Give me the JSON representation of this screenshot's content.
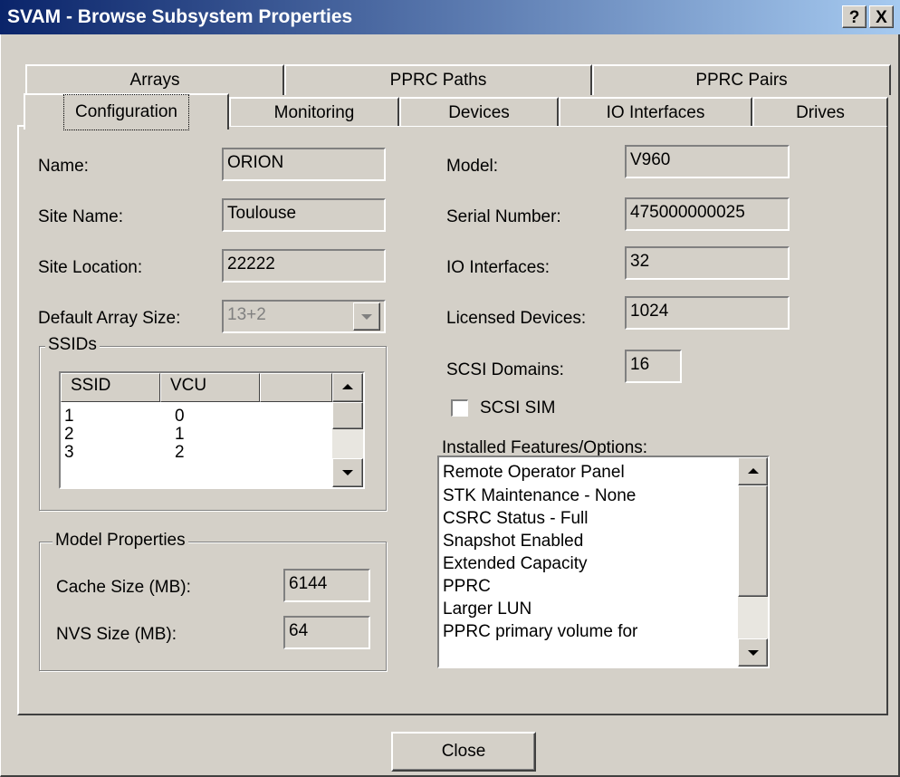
{
  "window": {
    "title": "SVAM - Browse Subsystem Properties",
    "help_label": "?",
    "close_label": "X"
  },
  "tabs_back": [
    {
      "label": "Arrays"
    },
    {
      "label": "PPRC Paths"
    },
    {
      "label": "PPRC Pairs"
    }
  ],
  "tabs_front": [
    {
      "label": "Configuration",
      "selected": true
    },
    {
      "label": "Monitoring"
    },
    {
      "label": "Devices"
    },
    {
      "label": "IO Interfaces"
    },
    {
      "label": "Drives"
    }
  ],
  "config": {
    "name_label": "Name:",
    "name_value": "ORION",
    "site_name_label": "Site Name:",
    "site_name_value": "Toulouse",
    "site_location_label": "Site Location:",
    "site_location_value": "22222",
    "default_array_label": "Default Array Size:",
    "default_array_value": "13+2",
    "model_label": "Model:",
    "model_value": "V960",
    "serial_label": "Serial Number:",
    "serial_value": "475000000025",
    "io_label": "IO Interfaces:",
    "io_value": "32",
    "licensed_label": "Licensed Devices:",
    "licensed_value": "1024",
    "scsi_domains_label": "SCSI Domains:",
    "scsi_domains_value": "16",
    "scsi_sim_label": "SCSI SIM",
    "scsi_sim_checked": false
  },
  "ssids": {
    "group_label": "SSIDs",
    "headers": [
      "SSID",
      "VCU",
      ""
    ],
    "rows": [
      {
        "ssid": "1",
        "vcu": "0"
      },
      {
        "ssid": "2",
        "vcu": "1"
      },
      {
        "ssid": "3",
        "vcu": "2"
      }
    ]
  },
  "model_properties": {
    "group_label": "Model Properties",
    "cache_label": "Cache Size (MB):",
    "cache_value": "6144",
    "nvs_label": "NVS Size (MB):",
    "nvs_value": "64"
  },
  "features": {
    "label": "Installed Features/Options:",
    "items": [
      "Remote Operator Panel",
      "STK Maintenance - None",
      "CSRC Status - Full",
      "Snapshot Enabled",
      "Extended Capacity",
      "PPRC",
      "Larger LUN",
      "PPRC primary volume for"
    ]
  },
  "buttons": {
    "close_label": "Close"
  },
  "colors": {
    "title_start": "#0a246a",
    "title_end": "#a6caf0",
    "face": "#d4d0c8"
  }
}
